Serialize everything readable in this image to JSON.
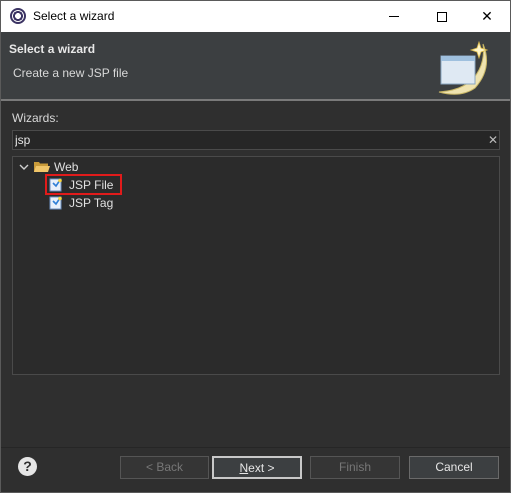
{
  "window": {
    "title": "Select a wizard",
    "controls": {
      "minimize": "—",
      "maximize": "□",
      "close": "✕"
    }
  },
  "header": {
    "title": "Select a wizard",
    "description": "Create a new JSP file",
    "banner_icon": "wizard-banner-icon"
  },
  "filter": {
    "label": "Wizards:",
    "value": "jsp",
    "clear_icon": "✕"
  },
  "tree": {
    "items": [
      {
        "label": "Web",
        "icon": "folder-open-icon",
        "expanded": true
      },
      {
        "label": "JSP File",
        "icon": "jsp-file-icon",
        "highlighted": true
      },
      {
        "label": "JSP Tag",
        "icon": "jsp-tag-icon"
      }
    ]
  },
  "buttons": {
    "help": "?",
    "back": "< Back",
    "next_mnemonic": "N",
    "next_rest": "ext >",
    "finish": "Finish",
    "cancel": "Cancel"
  },
  "colors": {
    "background": "#2f2f2f",
    "header_bg": "#3c3f41",
    "highlight_border": "#e11b1b"
  }
}
